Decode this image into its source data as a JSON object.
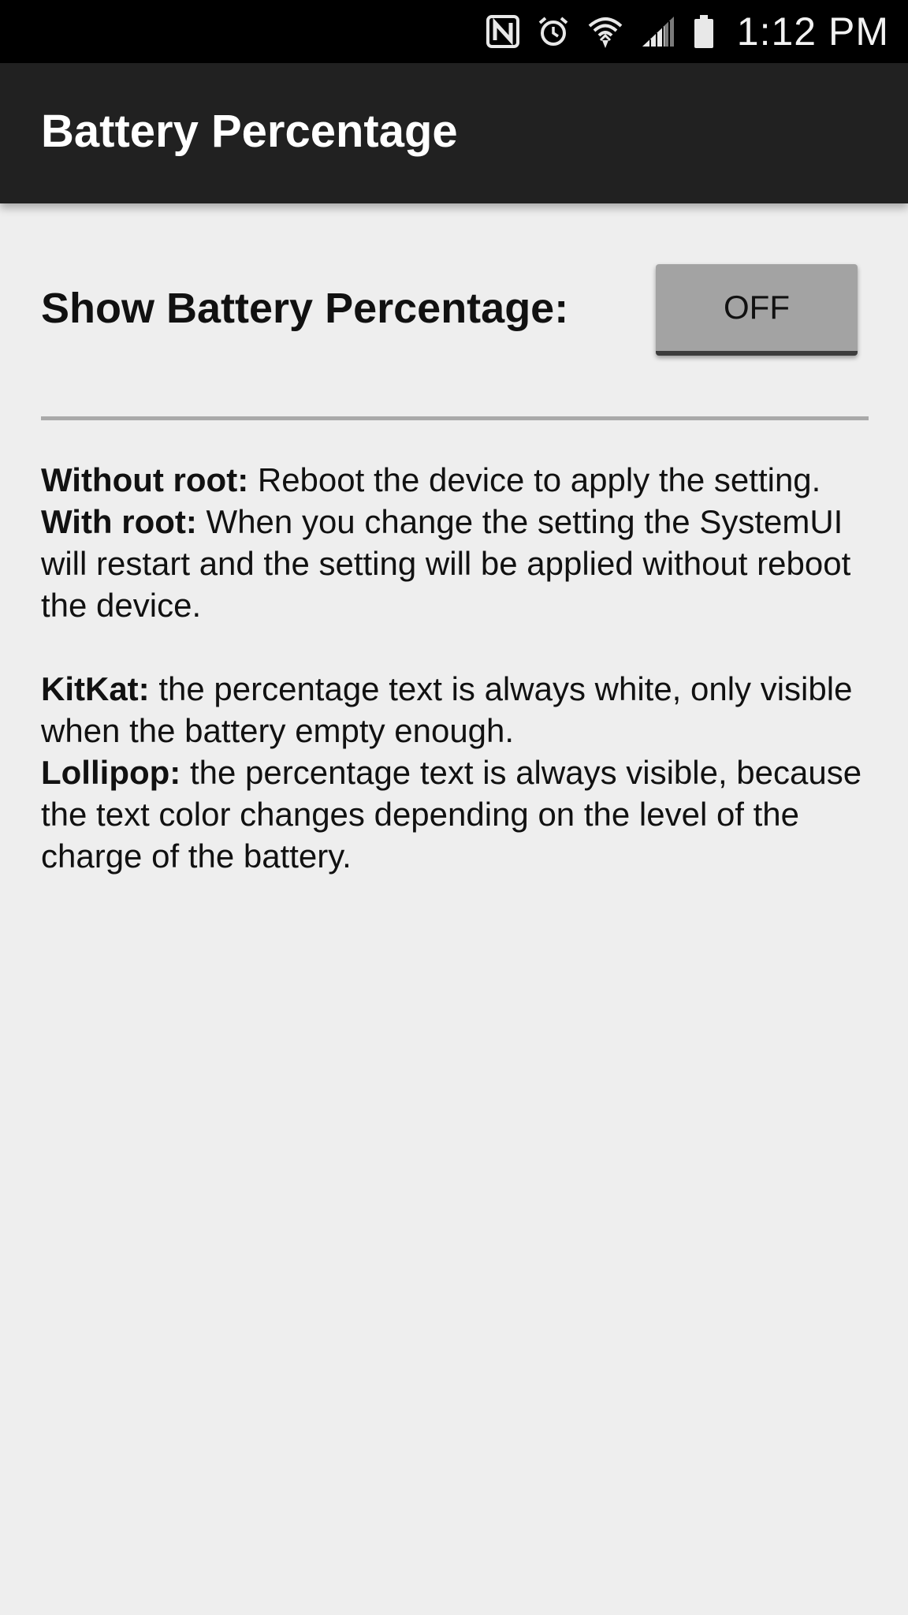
{
  "status_bar": {
    "time": "1:12 PM",
    "icons": [
      "nfc-icon",
      "alarm-icon",
      "wifi-icon",
      "signal-icon",
      "battery-icon"
    ]
  },
  "app_bar": {
    "title": "Battery Percentage"
  },
  "setting": {
    "label": "Show Battery Percentage:",
    "toggle_label": "OFF"
  },
  "info": {
    "without_root_label": "Without root:",
    "without_root_text": " Reboot the device to apply the setting.",
    "with_root_label": "With root:",
    "with_root_text": " When you change the setting the SystemUI will restart and the setting will be applied without reboot the device.",
    "kitkat_label": "KitKat:",
    "kitkat_text": " the percentage text is always white, only visible when the battery empty enough.",
    "lollipop_label": "Lollipop:",
    "lollipop_text": " the percentage text is always visible, because the text color changes depending on the level of the charge of the battery."
  },
  "colors": {
    "status_bar": "#000000",
    "app_bar": "#212121",
    "background": "#eeeeee",
    "toggle": "#a3a3a3"
  }
}
